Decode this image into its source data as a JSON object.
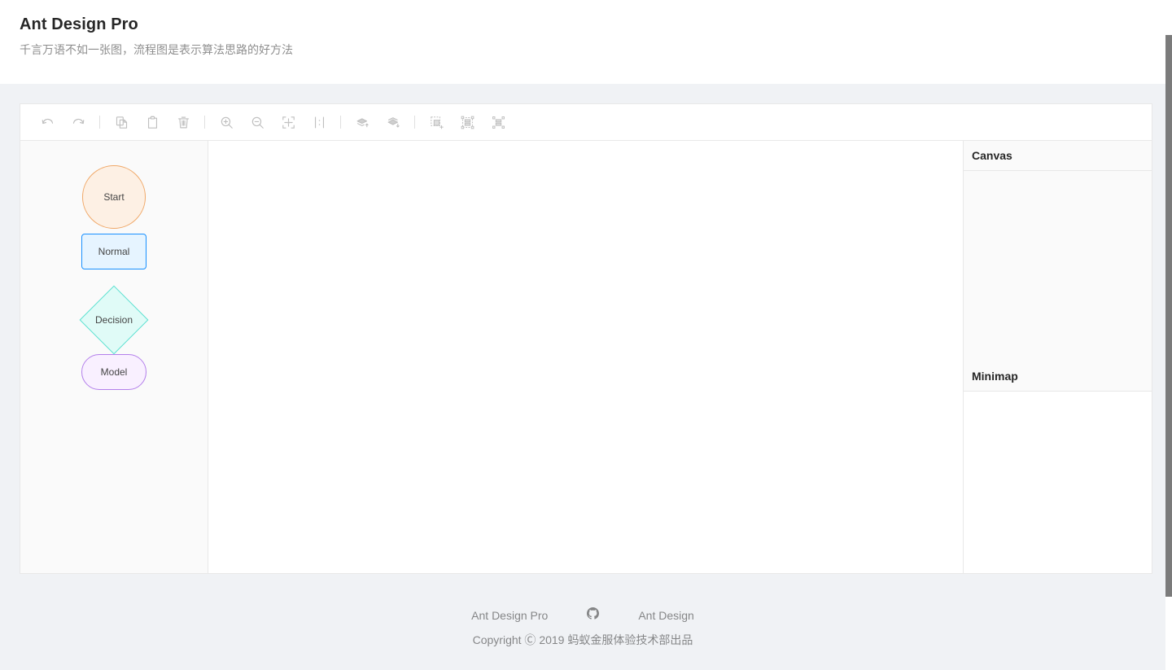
{
  "header": {
    "title": "Ant Design Pro",
    "description": "千言万语不如一张图，流程图是表示算法思路的好方法"
  },
  "toolbar": {
    "groups": [
      {
        "name": "history",
        "items": [
          {
            "icon": "undo-icon",
            "label": "Undo"
          },
          {
            "icon": "redo-icon",
            "label": "Redo"
          }
        ]
      },
      {
        "name": "clipboard",
        "items": [
          {
            "icon": "copy-icon",
            "label": "Copy"
          },
          {
            "icon": "paste-icon",
            "label": "Paste"
          },
          {
            "icon": "delete-icon",
            "label": "Delete"
          }
        ]
      },
      {
        "name": "zoom",
        "items": [
          {
            "icon": "zoom-in-icon",
            "label": "Zoom In"
          },
          {
            "icon": "zoom-out-icon",
            "label": "Zoom Out"
          },
          {
            "icon": "fit-to-screen-icon",
            "label": "Fit To Screen"
          },
          {
            "icon": "actual-size-icon",
            "label": "Actual Size"
          }
        ]
      },
      {
        "name": "layer",
        "items": [
          {
            "icon": "bring-to-front-icon",
            "label": "Bring To Front"
          },
          {
            "icon": "send-to-back-icon",
            "label": "Send To Back"
          }
        ]
      },
      {
        "name": "group",
        "items": [
          {
            "icon": "group-icon",
            "label": "Group"
          },
          {
            "icon": "ungroup-icon",
            "label": "Ungroup"
          },
          {
            "icon": "multi-select-icon",
            "label": "Multi Select"
          }
        ]
      }
    ]
  },
  "palette": {
    "items": [
      {
        "label": "Start",
        "shape": "circle",
        "fill": "#fdf0e4",
        "stroke": "#f0a868"
      },
      {
        "label": "Normal",
        "shape": "rect",
        "fill": "#e6f4ff",
        "stroke": "#1890ff"
      },
      {
        "label": "Decision",
        "shape": "diamond",
        "fill": "#e0fbf7",
        "stroke": "#5ae0d0"
      },
      {
        "label": "Model",
        "shape": "rounded-rect",
        "fill": "#f9f0ff",
        "stroke": "#b37feb"
      }
    ]
  },
  "right_panel": {
    "detail_title": "Canvas",
    "minimap_title": "Minimap"
  },
  "footer": {
    "links": [
      {
        "label": "Ant Design Pro",
        "icon": null
      },
      {
        "label": "github-icon",
        "icon": "github-icon"
      },
      {
        "label": "Ant Design",
        "icon": null
      }
    ],
    "copyright": "Copyright Ⓒ 2019 蚂蚁金服体验技术部出品"
  },
  "colors": {
    "page_background": "#f0f2f5",
    "panel_background": "#ffffff",
    "palette_background": "#fafafa",
    "border": "#e8e8e8",
    "text_primary": "#000000d9",
    "text_secondary": "#00000073",
    "icon": "#bfbfbf"
  }
}
